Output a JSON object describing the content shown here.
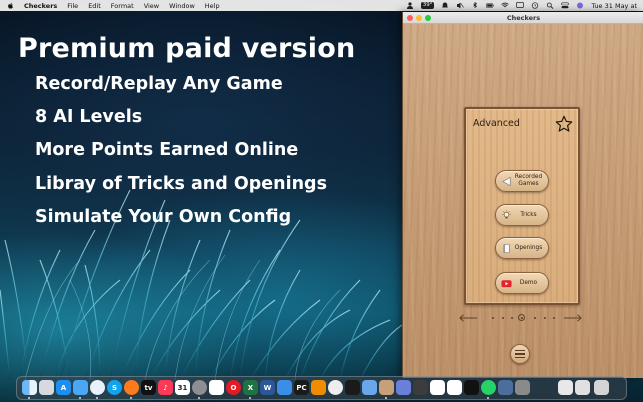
{
  "menubar": {
    "app_name": "Checkers",
    "menus": [
      "File",
      "Edit",
      "Format",
      "View",
      "Window",
      "Help"
    ],
    "temperature": "39°",
    "clock": "Tue 31 May at"
  },
  "promo": {
    "title": "Premium paid version",
    "features": [
      "Record/Replay Any Game",
      "8 AI Levels",
      "More Points Earned Online",
      "Libray of Tricks and Openings",
      "Simulate Your Own Config"
    ]
  },
  "window": {
    "title": "Checkers",
    "panel": {
      "level": "Advanced",
      "buttons": {
        "recorded_line1": "Recorded",
        "recorded_line2": "Games",
        "tricks": "Tricks",
        "openings": "Openings",
        "demo": "Demo"
      }
    },
    "pager": {
      "current": 4,
      "total": 7
    }
  },
  "colors": {
    "wood_light": "#e2b98a",
    "wood_dark": "#c59c75",
    "panel_border": "#7a5232",
    "demo_red": "#e6202a"
  },
  "icons": {
    "recorded": "play-back-icon",
    "tricks": "lightbulb-icon",
    "openings": "book-icon",
    "demo": "youtube-icon",
    "star": "star-icon"
  },
  "dock": {
    "apps": [
      "finder",
      "launchpad",
      "app-store",
      "mail",
      "safari",
      "skype",
      "firefox",
      "apple-tv",
      "music",
      "calendar",
      "settings",
      "pdf",
      "opera",
      "excel",
      "word",
      "xcode",
      "pycharm",
      "vlc",
      "chrome",
      "inkscape",
      "preview",
      "checkers",
      "vpn",
      "settings-2",
      "safari-2",
      "pdf-2",
      "pdf-3",
      "terminal",
      "whatsapp",
      "photos",
      "finder-2",
      "documents",
      "downloads",
      "trash"
    ]
  }
}
